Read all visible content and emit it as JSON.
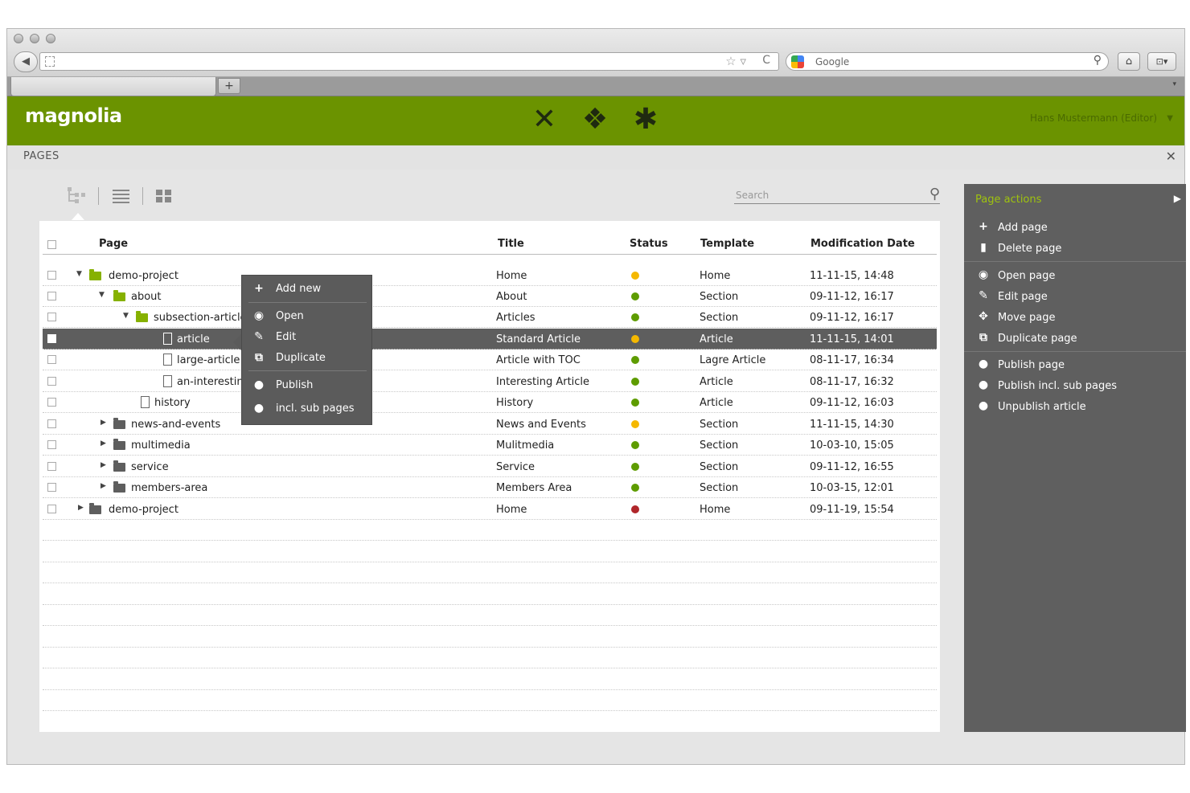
{
  "browser": {
    "back_glyph": "◀",
    "star_glyph": "☆ ▿",
    "reload_glyph": "C",
    "search_engine_label": "Google",
    "search_glyph": "⚲",
    "home_glyph": "⌂",
    "ext_glyph": "⊡▾",
    "new_tab_glyph": "+",
    "tab_overflow_glyph": "▾"
  },
  "app": {
    "logo": "magnolia",
    "app_icons": [
      "scissors-cross-icon",
      "diamond-pattern-icon",
      "asterisk-icon"
    ],
    "app_icon_glyphs": [
      "✕",
      "❖",
      "✱"
    ],
    "user": "Hans Mustermann (Editor)",
    "user_caret": "▼",
    "brand_color": "#6b9300"
  },
  "workbench": {
    "title": "PAGES",
    "close_glyph": "✕",
    "search_placeholder": "Search"
  },
  "grid": {
    "columns": {
      "page": "Page",
      "title": "Title",
      "status": "Status",
      "template": "Template",
      "modified": "Modification Date"
    },
    "rows": [
      {
        "name": "demo-project",
        "title": "Home",
        "status": "yellow",
        "template": "Home",
        "date": "11-11-15, 14:48"
      },
      {
        "name": "about",
        "title": "About",
        "status": "green",
        "template": "Section",
        "date": "09-11-12, 16:17"
      },
      {
        "name": "subsection-articles",
        "title": "Articles",
        "status": "green",
        "template": "Section",
        "date": "09-11-12, 16:17"
      },
      {
        "name": "article",
        "title": "Standard Article",
        "status": "yellow",
        "template": "Article",
        "date": "11-11-15, 14:01"
      },
      {
        "name": "large-article",
        "title": "Article with TOC",
        "status": "green",
        "template": "Lagre Article",
        "date": "08-11-17, 16:34"
      },
      {
        "name": "an-interestin",
        "title": "Interesting Article",
        "status": "green",
        "template": "Article",
        "date": "08-11-17, 16:32"
      },
      {
        "name": "history",
        "title": "History",
        "status": "green",
        "template": "Article",
        "date": "09-11-12, 16:03"
      },
      {
        "name": "news-and-events",
        "title": "News and Events",
        "status": "yellow",
        "template": "Section",
        "date": "11-11-15, 14:30"
      },
      {
        "name": "multimedia",
        "title": "Mulitmedia",
        "status": "green",
        "template": "Section",
        "date": "10-03-10, 15:05"
      },
      {
        "name": "service",
        "title": "Service",
        "status": "green",
        "template": "Section",
        "date": "09-11-12, 16:55"
      },
      {
        "name": "members-area",
        "title": "Members Area",
        "status": "green",
        "template": "Section",
        "date": "10-03-15, 12:01"
      },
      {
        "name": "demo-project",
        "title": "Home",
        "status": "red",
        "template": "Home",
        "date": "09-11-19, 15:54"
      }
    ],
    "status_colors": {
      "yellow": "#f5b800",
      "green": "#5e9c00",
      "red": "#b0262b"
    }
  },
  "context_menu": {
    "items": [
      {
        "icon": "+",
        "label": "Add new"
      },
      {
        "icon": "◉",
        "label": "Open"
      },
      {
        "icon": "✎",
        "label": "Edit"
      },
      {
        "icon": "⧉",
        "label": "Duplicate"
      },
      {
        "icon": "●",
        "label": "Publish"
      },
      {
        "icon": "●",
        "label": "incl. sub pages"
      }
    ]
  },
  "action_bar": {
    "title": "Page actions",
    "expand_glyph": "▶",
    "items": [
      {
        "icon": "+",
        "label": "Add page"
      },
      {
        "icon": "▮",
        "label": "Delete page"
      },
      {
        "icon": "◉",
        "label": "Open page"
      },
      {
        "icon": "✎",
        "label": "Edit page"
      },
      {
        "icon": "✥",
        "label": "Move page"
      },
      {
        "icon": "⧉",
        "label": "Duplicate page"
      },
      {
        "icon": "●",
        "label": "Publish page"
      },
      {
        "icon": "●",
        "label": "Publish incl. sub pages"
      },
      {
        "icon": "●",
        "label": "Unpublish article"
      }
    ]
  }
}
